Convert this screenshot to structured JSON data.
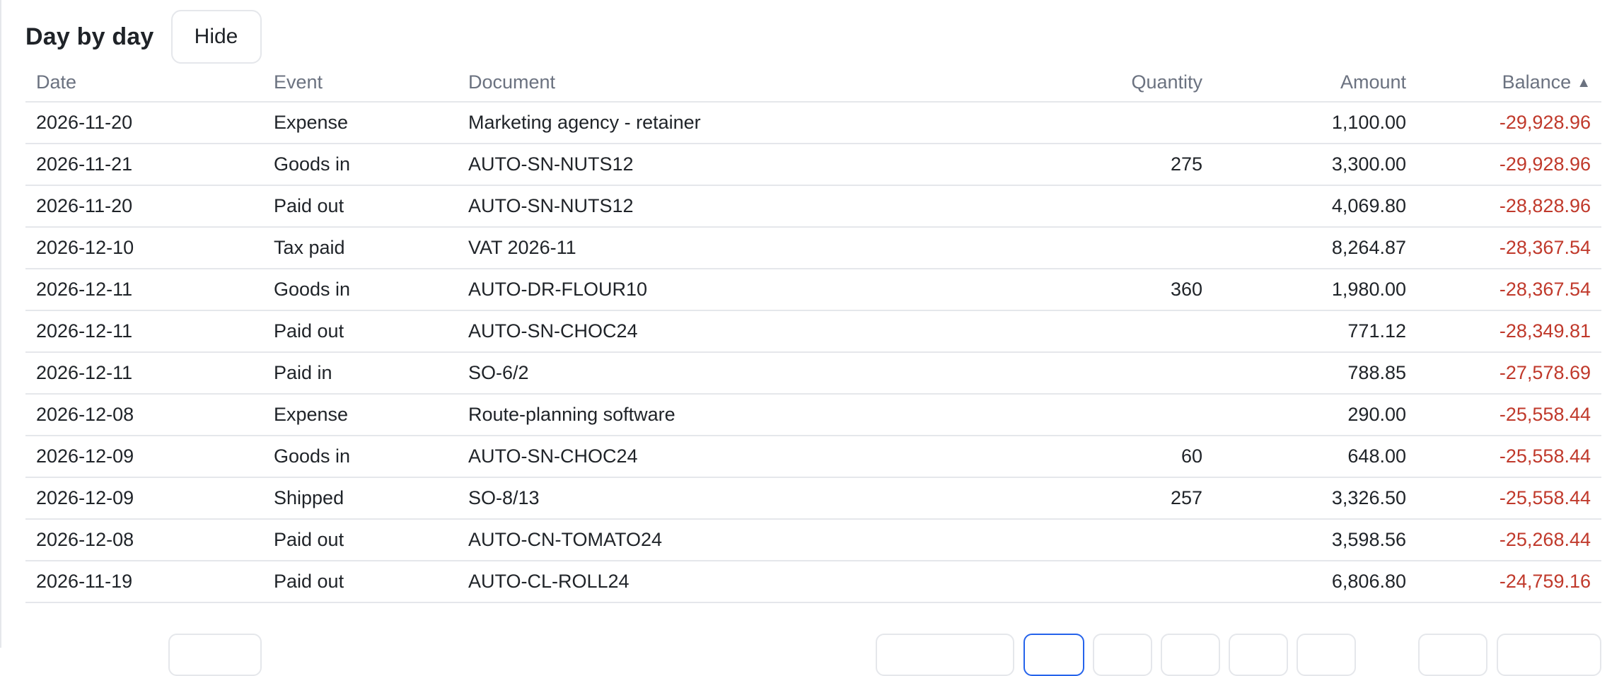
{
  "header": {
    "title": "Day by day",
    "hide_label": "Hide"
  },
  "table": {
    "columns": {
      "date": "Date",
      "event": "Event",
      "document": "Document",
      "quantity": "Quantity",
      "amount": "Amount",
      "balance": "Balance"
    },
    "sort_indicator": "▲",
    "rows": [
      {
        "date": "2026-11-20",
        "event": "Expense",
        "document": "Marketing agency - retainer",
        "quantity": "",
        "amount": "1,100.00",
        "balance": "-29,928.96"
      },
      {
        "date": "2026-11-21",
        "event": "Goods in",
        "document": "AUTO-SN-NUTS12",
        "quantity": "275",
        "amount": "3,300.00",
        "balance": "-29,928.96"
      },
      {
        "date": "2026-11-20",
        "event": "Paid out",
        "document": "AUTO-SN-NUTS12",
        "quantity": "",
        "amount": "4,069.80",
        "balance": "-28,828.96"
      },
      {
        "date": "2026-12-10",
        "event": "Tax paid",
        "document": "VAT 2026-11",
        "quantity": "",
        "amount": "8,264.87",
        "balance": "-28,367.54"
      },
      {
        "date": "2026-12-11",
        "event": "Goods in",
        "document": "AUTO-DR-FLOUR10",
        "quantity": "360",
        "amount": "1,980.00",
        "balance": "-28,367.54"
      },
      {
        "date": "2026-12-11",
        "event": "Paid out",
        "document": "AUTO-SN-CHOC24",
        "quantity": "",
        "amount": "771.12",
        "balance": "-28,349.81"
      },
      {
        "date": "2026-12-11",
        "event": "Paid in",
        "document": "SO-6/2",
        "quantity": "",
        "amount": "788.85",
        "balance": "-27,578.69"
      },
      {
        "date": "2026-12-08",
        "event": "Expense",
        "document": "Route-planning software",
        "quantity": "",
        "amount": "290.00",
        "balance": "-25,558.44"
      },
      {
        "date": "2026-12-09",
        "event": "Goods in",
        "document": "AUTO-SN-CHOC24",
        "quantity": "60",
        "amount": "648.00",
        "balance": "-25,558.44"
      },
      {
        "date": "2026-12-09",
        "event": "Shipped",
        "document": "SO-8/13",
        "quantity": "257",
        "amount": "3,326.50",
        "balance": "-25,558.44"
      },
      {
        "date": "2026-12-08",
        "event": "Paid out",
        "document": "AUTO-CN-TOMATO24",
        "quantity": "",
        "amount": "3,598.56",
        "balance": "-25,268.44"
      },
      {
        "date": "2026-11-19",
        "event": "Paid out",
        "document": "AUTO-CL-ROLL24",
        "quantity": "",
        "amount": "6,806.80",
        "balance": "-24,759.16"
      }
    ]
  },
  "colors": {
    "negative": "#c0392b",
    "border": "#e5e7eb",
    "header_text": "#6b7280",
    "active_page": "#2563eb"
  }
}
